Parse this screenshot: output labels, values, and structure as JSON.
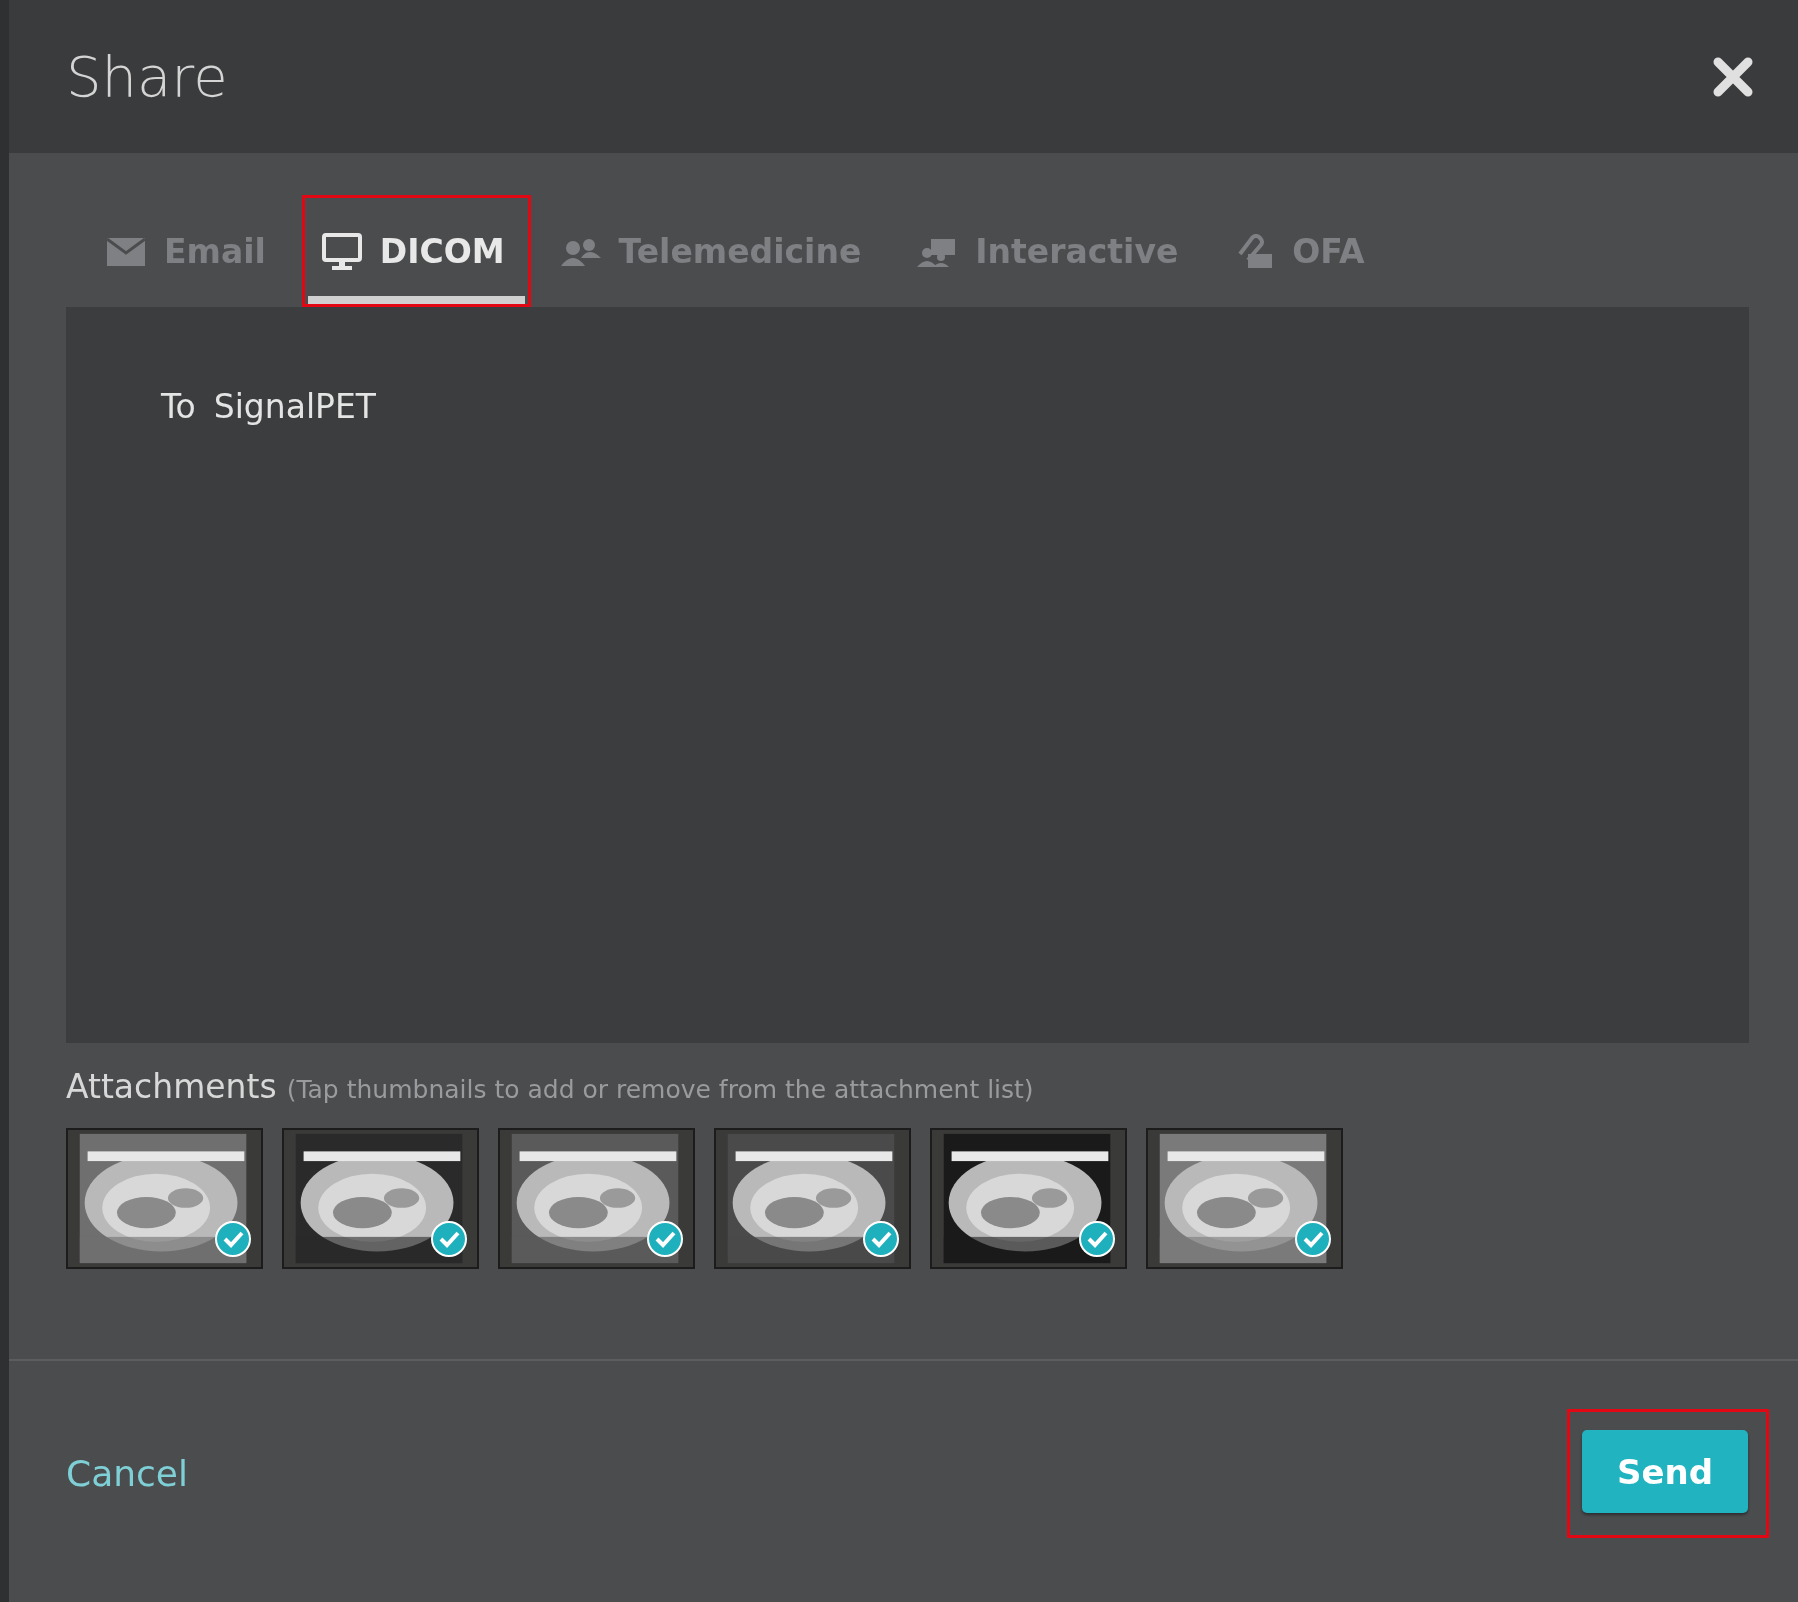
{
  "dialog": {
    "title": "Share"
  },
  "tabs": [
    {
      "label": "Email",
      "selected": false,
      "highlighted": false
    },
    {
      "label": "DICOM",
      "selected": true,
      "highlighted": true
    },
    {
      "label": "Telemedicine",
      "selected": false,
      "highlighted": false
    },
    {
      "label": "Interactive",
      "selected": false,
      "highlighted": false
    },
    {
      "label": "OFA",
      "selected": false,
      "highlighted": false
    }
  ],
  "message": {
    "to_label": "To",
    "recipient": "SignalPET"
  },
  "attachments": {
    "label": "Attachments",
    "hint": "(Tap thumbnails to add or remove from the attachment list)",
    "thumbnails": [
      {
        "kind": "picture",
        "selected": true
      },
      {
        "kind": "picture",
        "selected": true
      },
      {
        "kind": "picture",
        "selected": true
      },
      {
        "kind": "picture",
        "selected": true
      },
      {
        "kind": "picture",
        "selected": true
      },
      {
        "kind": "picture",
        "selected": true
      }
    ]
  },
  "footer": {
    "cancel": "Cancel",
    "send": {
      "label": "Send",
      "highlighted": true
    }
  }
}
